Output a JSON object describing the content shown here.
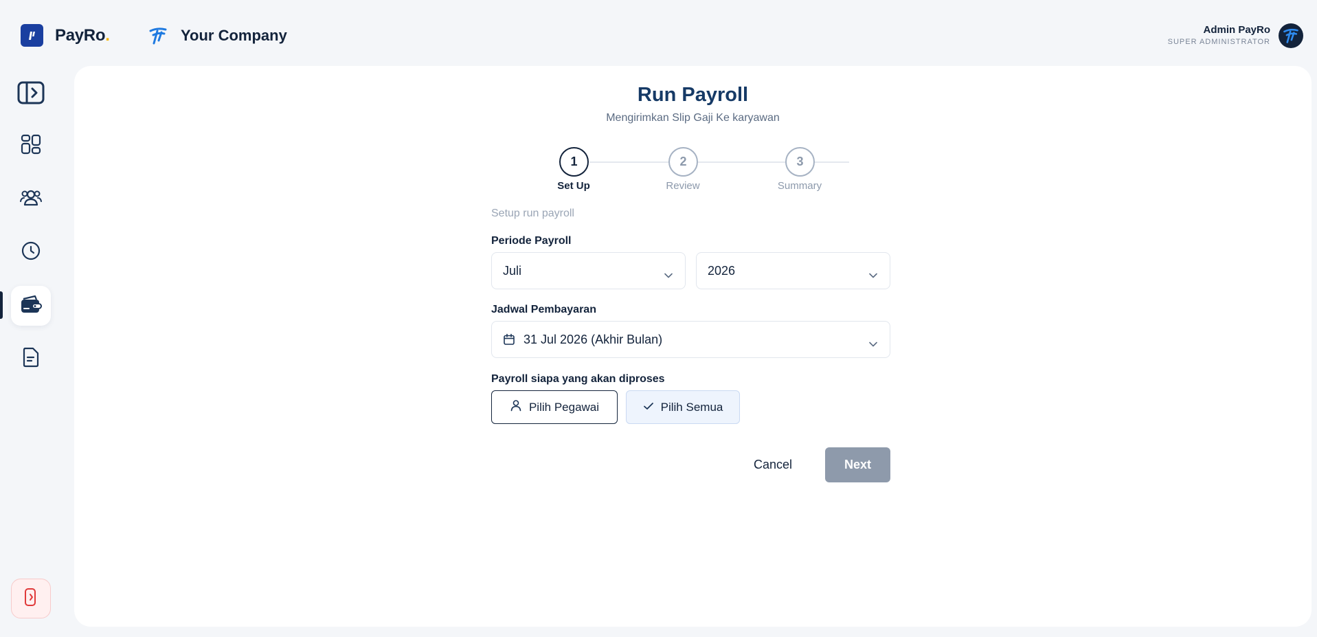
{
  "brand": {
    "name": "PayRo",
    "dot": "."
  },
  "company": {
    "name": "Your Company"
  },
  "user": {
    "name": "Admin PayRo",
    "role": "SUPER ADMINISTRATOR"
  },
  "sidebar": {
    "items": [
      {
        "name": "sidebar-toggle",
        "icon": "sidebar-toggle-icon"
      },
      {
        "name": "dashboard",
        "icon": "dashboard-grid-icon"
      },
      {
        "name": "employees",
        "icon": "users-icon"
      },
      {
        "name": "attendance",
        "icon": "clock-icon"
      },
      {
        "name": "payroll",
        "icon": "wallet-icon",
        "active": true
      },
      {
        "name": "reports",
        "icon": "document-icon"
      }
    ],
    "logout_icon": "logout-icon"
  },
  "page": {
    "title": "Run Payroll",
    "subtitle": "Mengirimkan Slip Gaji Ke karyawan"
  },
  "stepper": {
    "steps": [
      {
        "number": "1",
        "label": "Set Up",
        "active": true
      },
      {
        "number": "2",
        "label": "Review",
        "active": false
      },
      {
        "number": "3",
        "label": "Summary",
        "active": false
      }
    ]
  },
  "form": {
    "section_hint": "Setup run payroll",
    "periode_label": "Periode Payroll",
    "month_value": "Juli",
    "year_value": "2026",
    "jadwal_label": "Jadwal Pembayaran",
    "jadwal_value": "31 Jul 2026 (Akhir Bulan)",
    "who_label": "Payroll siapa yang akan diproses",
    "pilih_pegawai": "Pilih Pegawai",
    "pilih_semua": "Pilih Semua",
    "cancel": "Cancel",
    "next": "Next"
  },
  "colors": {
    "primary": "#13233b",
    "title": "#163a66",
    "brand_blue": "#1a3fa0",
    "accent_yellow": "#f5b400",
    "next_disabled": "#8e9aab",
    "logout_red": "#e03a3a"
  }
}
